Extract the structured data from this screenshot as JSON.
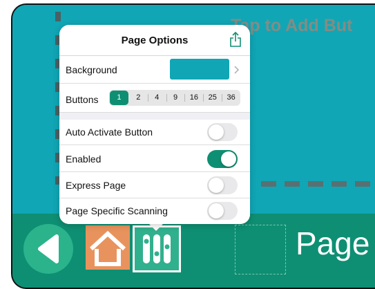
{
  "canvas": {
    "tap_hint": "Tap to Add But",
    "background_color": "#10a6b5"
  },
  "toolbar": {
    "back_icon": "back-arrow-icon",
    "home_icon": "home-icon",
    "options_icon": "sliders-icon",
    "page_label": "Page"
  },
  "popover": {
    "title": "Page Options",
    "share_icon": "share-icon",
    "background": {
      "label": "Background",
      "color": "#10a6b5"
    },
    "buttons": {
      "label": "Buttons",
      "options": [
        "1",
        "2",
        "4",
        "9",
        "16",
        "25",
        "36"
      ],
      "selected": "1"
    },
    "toggles": [
      {
        "label": "Auto Activate Button",
        "on": false
      },
      {
        "label": "Enabled",
        "on": true
      },
      {
        "label": "Express Page",
        "on": false
      },
      {
        "label": "Page Specific Scanning",
        "on": false
      }
    ]
  },
  "colors": {
    "accent": "#0e8f73",
    "toolbar": "#0e8f73",
    "home": "#e8935e"
  }
}
